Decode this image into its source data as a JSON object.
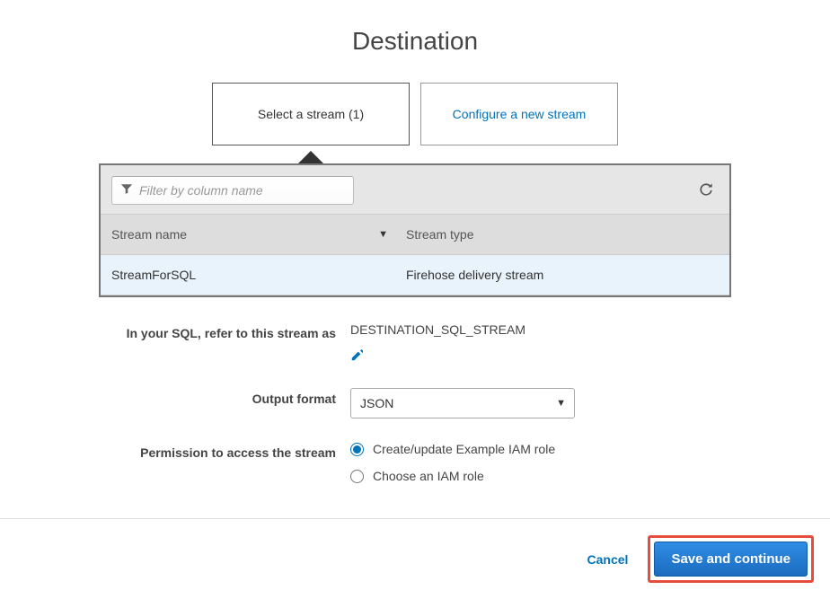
{
  "title": "Destination",
  "tabs": {
    "select": "Select a stream (1)",
    "configure": "Configure a new stream"
  },
  "filter": {
    "placeholder": "Filter by column name"
  },
  "table": {
    "columns": {
      "name": "Stream name",
      "type": "Stream type"
    },
    "rows": [
      {
        "name": "StreamForSQL",
        "type": "Firehose delivery stream"
      }
    ]
  },
  "sqlRefer": {
    "label": "In your SQL, refer to this stream as",
    "value": "DESTINATION_SQL_STREAM"
  },
  "outputFormat": {
    "label": "Output format",
    "value": "JSON"
  },
  "permission": {
    "label": "Permission to access the stream",
    "options": [
      {
        "label": "Create/update Example IAM role",
        "checked": true
      },
      {
        "label": "Choose an IAM role",
        "checked": false
      }
    ]
  },
  "footer": {
    "cancel": "Cancel",
    "save": "Save and continue"
  }
}
